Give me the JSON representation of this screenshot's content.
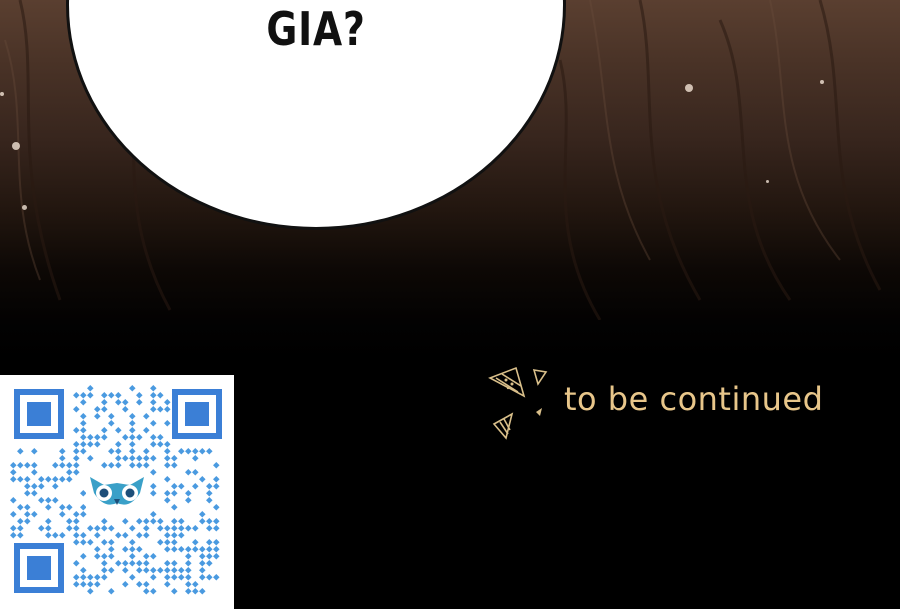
{
  "bubble": {
    "text": "GIA?"
  },
  "caption": {
    "text": "to be continued",
    "color": "#e8c68a"
  },
  "qr_code": {
    "finder_color": "#3b7fd6",
    "module_color": "#4a9ae0",
    "logo_icon": "owl-icon"
  },
  "colors": {
    "background_top": "#5a3f30",
    "background_bottom": "#000000",
    "bubble_fill": "#ffffff"
  }
}
